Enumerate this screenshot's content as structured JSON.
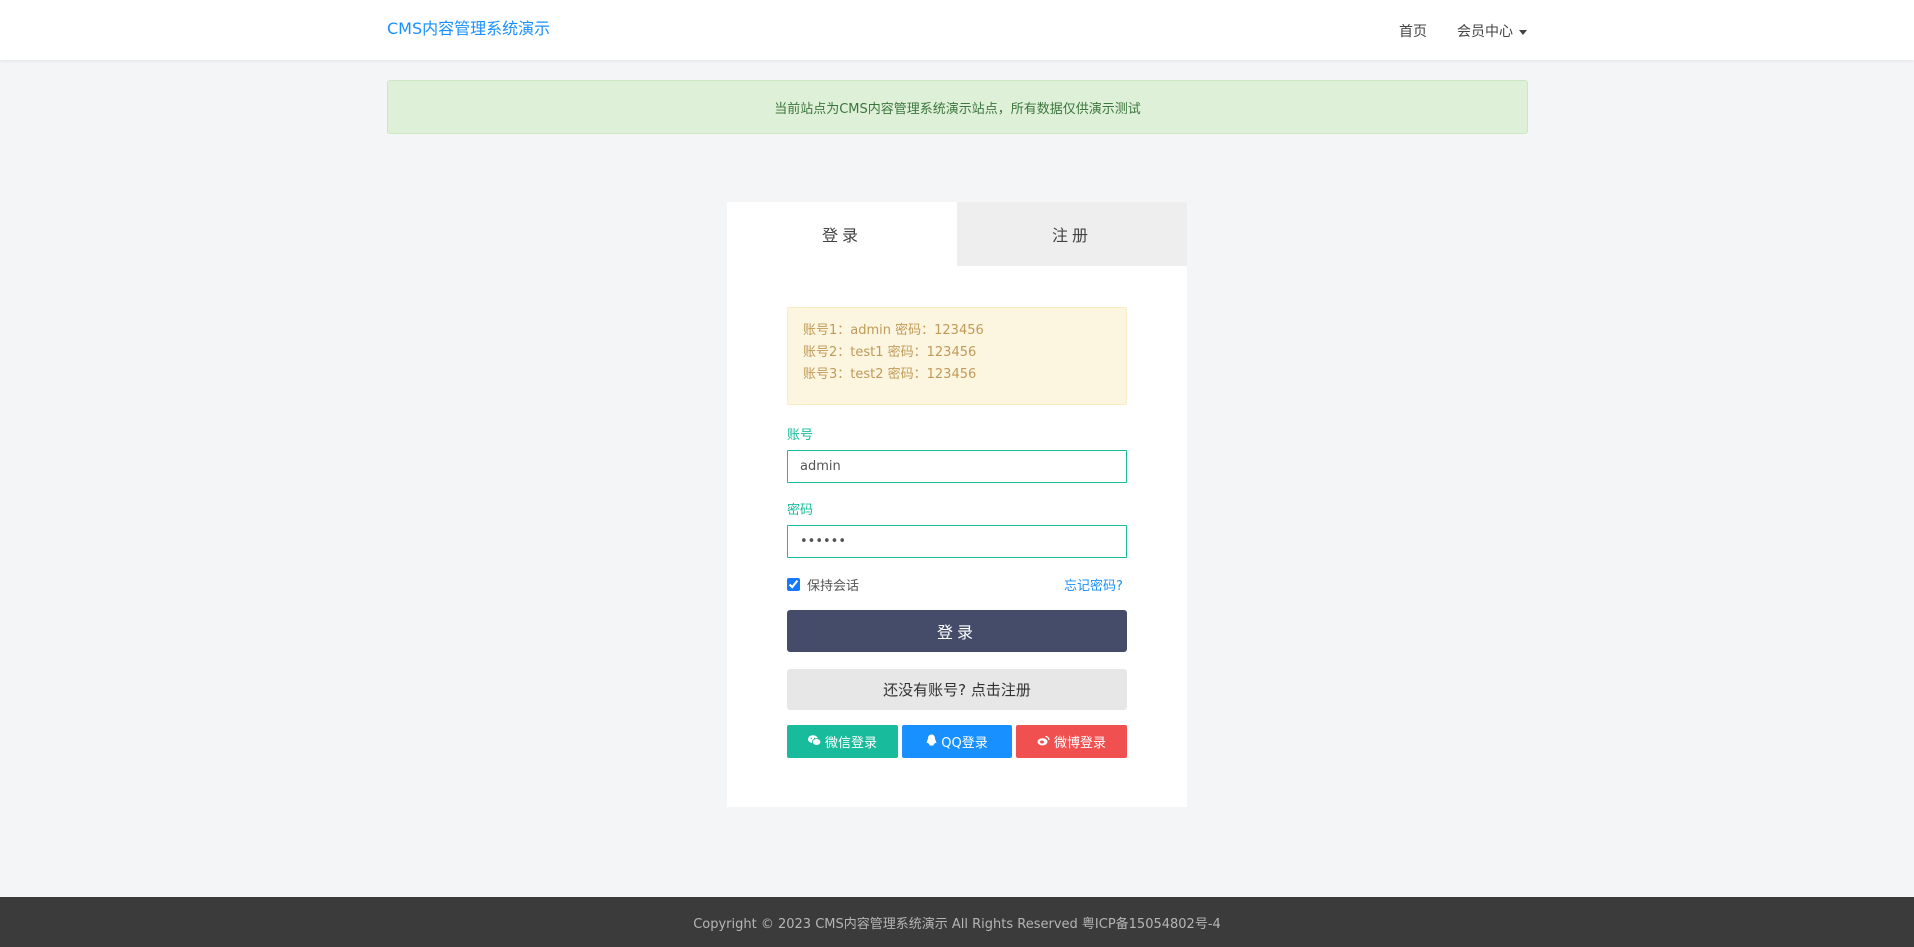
{
  "header": {
    "brand": "CMS内容管理系统演示",
    "nav_home": "首页",
    "nav_member": "会员中心"
  },
  "notice": "当前站点为CMS内容管理系统演示站点，所有数据仅供演示测试",
  "tabs": [
    {
      "label": "登录"
    },
    {
      "label": "注册"
    }
  ],
  "hint_lines": [
    "账号1：admin 密码：123456",
    "账号2：test1 密码：123456",
    "账号3：test2 密码：123456"
  ],
  "form": {
    "account_label": "账号",
    "account_value": "admin",
    "password_label": "密码",
    "password_value": "123456",
    "remember_label": "保持会话",
    "remember_checked": true,
    "forgot_label": "忘记密码?",
    "login_button": "登录",
    "register_button": "还没有账号? 点击注册"
  },
  "social": {
    "wechat": "微信登录",
    "qq": "QQ登录",
    "weibo": "微博登录"
  },
  "footer": "Copyright © 2023 CMS内容管理系统演示 All Rights Reserved 粤ICP备15054802号-4",
  "colors": {
    "brand": "#1890ff",
    "accent": "#18bc9c",
    "login_button": "#444c69",
    "wechat": "#18bc9c",
    "qq": "#1890ff",
    "weibo": "#f05050"
  }
}
